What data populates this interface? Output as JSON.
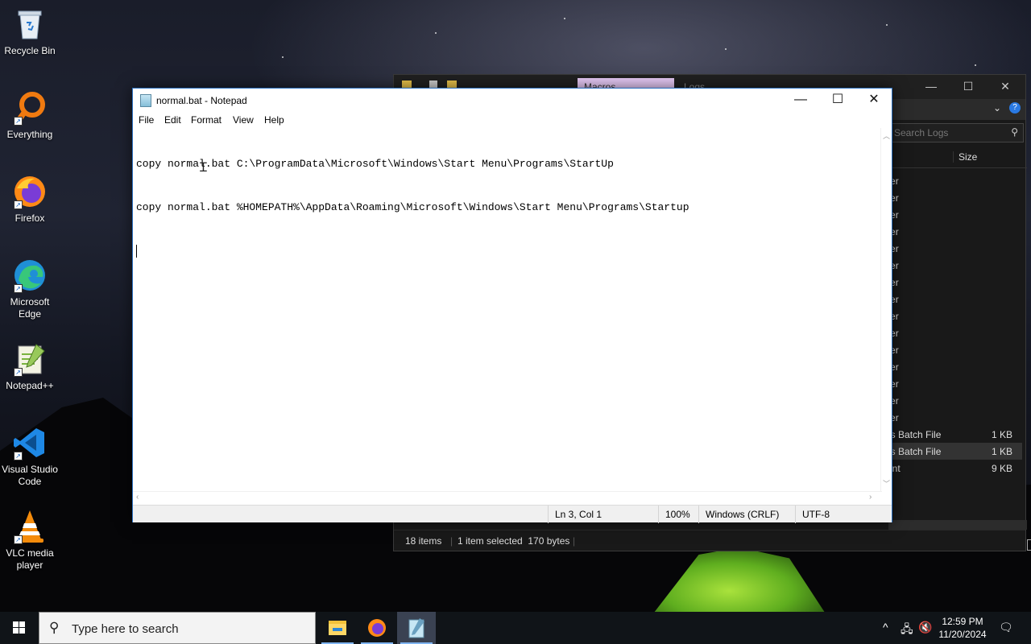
{
  "desktop": {
    "icons": [
      {
        "label": "Recycle Bin",
        "icon": "recycle-bin-icon"
      },
      {
        "label": "Everything",
        "icon": "everything-search-icon"
      },
      {
        "label": "Firefox",
        "icon": "firefox-icon"
      },
      {
        "label": "Microsoft Edge",
        "icon": "edge-icon"
      },
      {
        "label": "Notepad++",
        "icon": "notepadpp-icon"
      },
      {
        "label": "Visual Studio Code",
        "icon": "vscode-icon"
      },
      {
        "label": "VLC media player",
        "icon": "vlc-icon"
      }
    ]
  },
  "explorer": {
    "active_tab": "Macros",
    "inactive_tab": "Logs",
    "search_placeholder": "Search Logs",
    "column_size": "Size",
    "rows": [
      {
        "type": "File folder",
        "size": ""
      },
      {
        "type": "File folder",
        "size": ""
      },
      {
        "type": "File folder",
        "size": ""
      },
      {
        "type": "File folder",
        "size": ""
      },
      {
        "type": "File folder",
        "size": ""
      },
      {
        "type": "File folder",
        "size": ""
      },
      {
        "type": "File folder",
        "size": ""
      },
      {
        "type": "File folder",
        "size": ""
      },
      {
        "type": "File folder",
        "size": ""
      },
      {
        "type": "File folder",
        "size": ""
      },
      {
        "type": "File folder",
        "size": ""
      },
      {
        "type": "File folder",
        "size": ""
      },
      {
        "type": "File folder",
        "size": ""
      },
      {
        "type": "File folder",
        "size": ""
      },
      {
        "type": "File folder",
        "size": ""
      },
      {
        "type": "Windows Batch File",
        "size": "1 KB"
      },
      {
        "type": "Windows Batch File",
        "size": "1 KB"
      },
      {
        "type": "Document",
        "size": "9 KB"
      }
    ],
    "selected_row": 16,
    "status": {
      "items": "18 items",
      "selected": "1 item selected  170 bytes"
    }
  },
  "notepad": {
    "title": "normal.bat - Notepad",
    "menu": [
      "File",
      "Edit",
      "Format",
      "View",
      "Help"
    ],
    "lines": [
      "copy normal.bat C:\\ProgramData\\Microsoft\\Windows\\Start Menu\\Programs\\StartUp",
      "copy normal.bat %HOMEPATH%\\AppData\\Roaming\\Microsoft\\Windows\\Start Menu\\Programs\\Startup",
      ""
    ],
    "status": {
      "position": "Ln 3, Col 1",
      "zoom": "100%",
      "line_endings": "Windows (CRLF)",
      "encoding": "UTF-8"
    },
    "controls": {
      "minimize": "—",
      "maximize": "☐",
      "close": "✕"
    }
  },
  "taskbar": {
    "search_placeholder": "Type here to search",
    "apps": [
      "file-explorer-icon",
      "firefox-icon",
      "notepad-icon"
    ],
    "active_app": "notepad-icon",
    "time": "12:59 PM",
    "date": "11/20/2024"
  }
}
